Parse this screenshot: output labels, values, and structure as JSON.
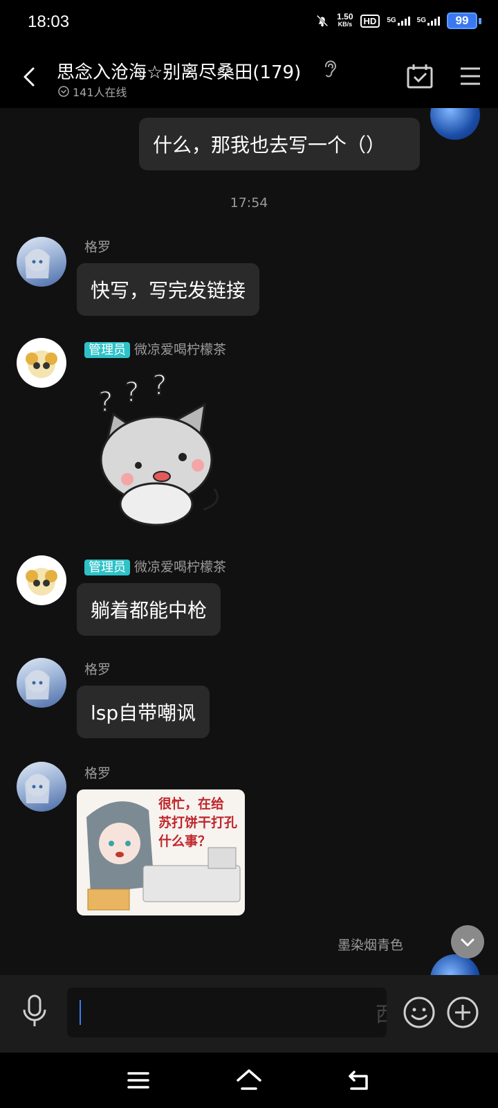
{
  "status": {
    "time": "18:03",
    "speed_top": "1.50",
    "speed_unit": "KB/s",
    "hd": "HD",
    "net1": "5G",
    "net2": "5G",
    "battery": "99"
  },
  "header": {
    "title": "思念入沧海☆别离尽桑田(179)",
    "online": "141人在线"
  },
  "messages": {
    "m1_text": "什么，那我也去写一个（）",
    "time_sep": "17:54",
    "m2_name": "格罗",
    "m2_text": "快写，写完发链接",
    "m3_badge": "管理员",
    "m3_name": "微凉爱喝柠檬茶",
    "m4_badge": "管理员",
    "m4_name": "微凉爱喝柠檬茶",
    "m4_text": "躺着都能中枪",
    "m5_name": "格罗",
    "m5_text": "lsp自带嘲讽",
    "m6_name": "格罗",
    "m6_img_text": [
      "很忙，在给",
      "苏打饼干打孔",
      "什么事？"
    ],
    "m7_name": "墨染烟青色",
    "m7_partial": "西"
  },
  "input": {
    "value": ""
  },
  "colors": {
    "background": "#111111",
    "bubble": "#2a2a2a",
    "admin_badge": "#2ec2c8",
    "caret": "#3d7df5",
    "battery": "#3a78f2"
  },
  "icons": [
    "back-icon",
    "ear-icon",
    "online-check-icon",
    "calendar-check-icon",
    "menu-icon",
    "scroll-down-icon",
    "mic-icon",
    "emoji-icon",
    "plus-icon",
    "nav-menu-icon",
    "nav-home-icon",
    "nav-back-icon"
  ]
}
